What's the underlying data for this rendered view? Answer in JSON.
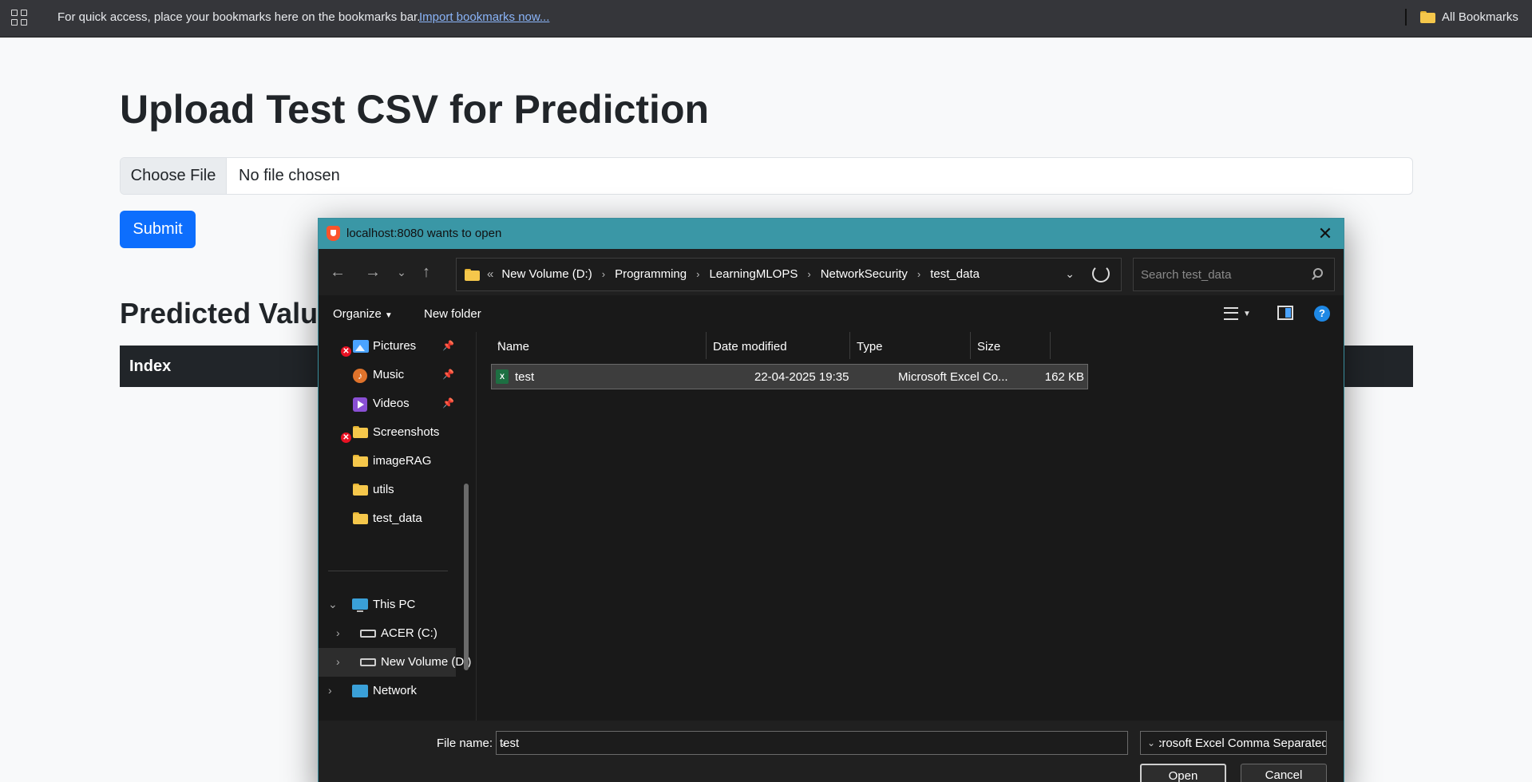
{
  "bookmarks_bar": {
    "message": "For quick access, place your bookmarks here on the bookmarks bar.",
    "import_link": "Import bookmarks now...",
    "all_bookmarks": "All Bookmarks"
  },
  "page": {
    "title": "Upload Test CSV for Prediction",
    "choose_file": "Choose File",
    "no_file": "No file chosen",
    "submit": "Submit",
    "predicted_title": "Predicted Value",
    "table_header_index": "Index"
  },
  "dialog": {
    "title": "localhost:8080 wants to open",
    "breadcrumb": [
      "New Volume (D:)",
      "Programming",
      "LearningMLOPS",
      "NetworkSecurity",
      "test_data"
    ],
    "breadcrumb_prefix": "«",
    "search_placeholder": "Search test_data",
    "organize": "Organize",
    "new_folder": "New folder",
    "help": "?",
    "nav_items": [
      {
        "label": "Pictures",
        "icon": "pictures-icon",
        "pinned": true,
        "error": true
      },
      {
        "label": "Music",
        "icon": "music-icon",
        "pinned": true,
        "error": false
      },
      {
        "label": "Videos",
        "icon": "videos-icon",
        "pinned": true,
        "error": false
      },
      {
        "label": "Screenshots",
        "icon": "folder-icon",
        "pinned": false,
        "error": true
      },
      {
        "label": "imageRAG",
        "icon": "folder-icon",
        "pinned": false,
        "error": false
      },
      {
        "label": "utils",
        "icon": "folder-icon",
        "pinned": false,
        "error": false
      },
      {
        "label": "test_data",
        "icon": "folder-icon",
        "pinned": false,
        "error": false
      }
    ],
    "tree_items": [
      {
        "label": "This PC",
        "icon": "pc-icon",
        "expanded": true
      },
      {
        "label": "ACER (C:)",
        "icon": "drive-icon",
        "expanded": false
      },
      {
        "label": "New Volume (D:)",
        "icon": "drive-icon",
        "expanded": false,
        "selected": true
      },
      {
        "label": "Network",
        "icon": "network-icon",
        "expanded": false
      }
    ],
    "columns": [
      "Name",
      "Date modified",
      "Type",
      "Size"
    ],
    "files": [
      {
        "name": "test",
        "date": "22-04-2025 19:35",
        "type": "Microsoft Excel Co...",
        "size": "162 KB"
      }
    ],
    "file_name_label": "File name:",
    "file_name_value": "test",
    "file_type": "Microsoft Excel Comma Separated Values File",
    "open": "Open",
    "cancel": "Cancel"
  },
  "colors": {
    "bootstrap_primary": "#0d6efd",
    "dialog_titlebar": "#3a97a6",
    "dark_header": "#212529"
  }
}
